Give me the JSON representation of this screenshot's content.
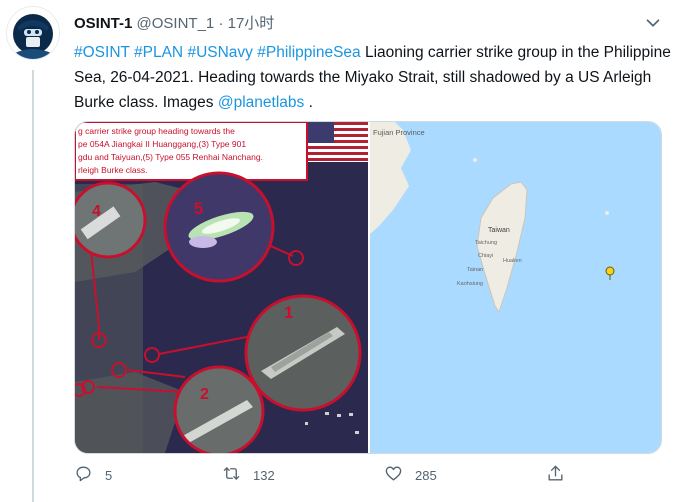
{
  "tweet": {
    "author_name": "OSINT-1",
    "handle": "@OSINT_1",
    "separator": "·",
    "time": "17小时",
    "text": {
      "hashtags": [
        "#OSINT",
        "#PLAN",
        "#USNavy",
        "#PhilippineSea"
      ],
      "body": " Liaoning carrier strike group in the Philippine Sea, 26-04-2021. Heading towards the Miyako Strait, still shadowed by a US Arleigh Burke class. Images ",
      "mention": "@planetlabs",
      "trailing": " ."
    }
  },
  "media": {
    "caption_lines": [
      "g carrier strike group heading towards the",
      "pe 054A  Jiangkai II Huanggang,(3) Type 901",
      "gdu and Taiyuan,(5) Type 055 Renhai Nanchang.",
      "rleigh Burke class."
    ],
    "markers": [
      "1",
      "2",
      "4",
      "5"
    ],
    "map_labels": {
      "province": "Fujian Province",
      "island": "Taiwan",
      "cities": [
        "Taichung",
        "Chiayi",
        "Tainan",
        "Kaohsiung",
        "Hualien"
      ]
    }
  },
  "actions": {
    "reply_count": "5",
    "retweet_count": "132",
    "like_count": "285"
  },
  "icons": [
    "avatar",
    "more-icon",
    "us-flag-icon",
    "map-pin-icon",
    "reply-icon",
    "retweet-icon",
    "like-icon",
    "share-icon"
  ],
  "colors": {
    "link": "#1b95e0",
    "annotation_red": "#c8102e",
    "muted": "#536471"
  }
}
